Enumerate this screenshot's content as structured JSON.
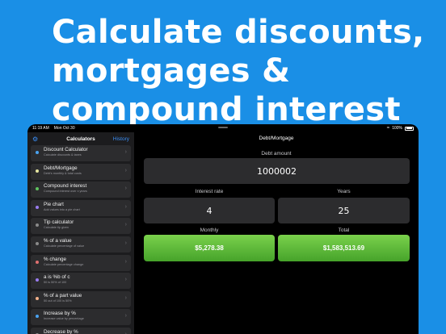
{
  "headline": [
    "Calculate discounts,",
    "mortgages &",
    "compound interest"
  ],
  "status": {
    "time": "11:19 AM",
    "date": "Mon Oct 30",
    "battery": "100%"
  },
  "sidebar": {
    "title": "Calculators",
    "history": "History",
    "items": [
      {
        "name": "Discount Calculator",
        "sub": "Calculate discounts & taxes",
        "color": "#4aa3f0"
      },
      {
        "name": "Debt/Mortgage",
        "sub": "Debt's monthly & total costs",
        "color": "#e6e6a0"
      },
      {
        "name": "Compound interest",
        "sub": "Compound interest over x years",
        "color": "#5fc35f"
      },
      {
        "name": "Pie chart",
        "sub": "Add values into a pie chart",
        "color": "#9a7cf0"
      },
      {
        "name": "Tip calculator",
        "sub": "Calculate tip given",
        "color": "#8a8a8a"
      },
      {
        "name": "% of a value",
        "sub": "Calculate percentage of value",
        "color": "#8a8a8a"
      },
      {
        "name": "% change",
        "sub": "Calculate percentage change",
        "color": "#e07070"
      },
      {
        "name": "a is %b of c",
        "sub": "50 is 50% of 100",
        "color": "#9a7cf0"
      },
      {
        "name": "% of a part value",
        "sub": "50 out of 100 is 50%",
        "color": "#f2b08a"
      },
      {
        "name": "Increase by %",
        "sub": "Increase value by percentage",
        "color": "#4aa3f0"
      },
      {
        "name": "Decrease by %",
        "sub": "",
        "color": "#8a8a8a"
      }
    ]
  },
  "main": {
    "title": "Debt/Mortgage",
    "debt_label": "Debt amount",
    "debt_value": "1000002",
    "rate_label": "Interest rate",
    "rate_value": "4",
    "years_label": "Years",
    "years_value": "25",
    "monthly_label": "Monthly",
    "monthly_value": "$5,278.38",
    "total_label": "Total",
    "total_value": "$1,583,513.69"
  }
}
